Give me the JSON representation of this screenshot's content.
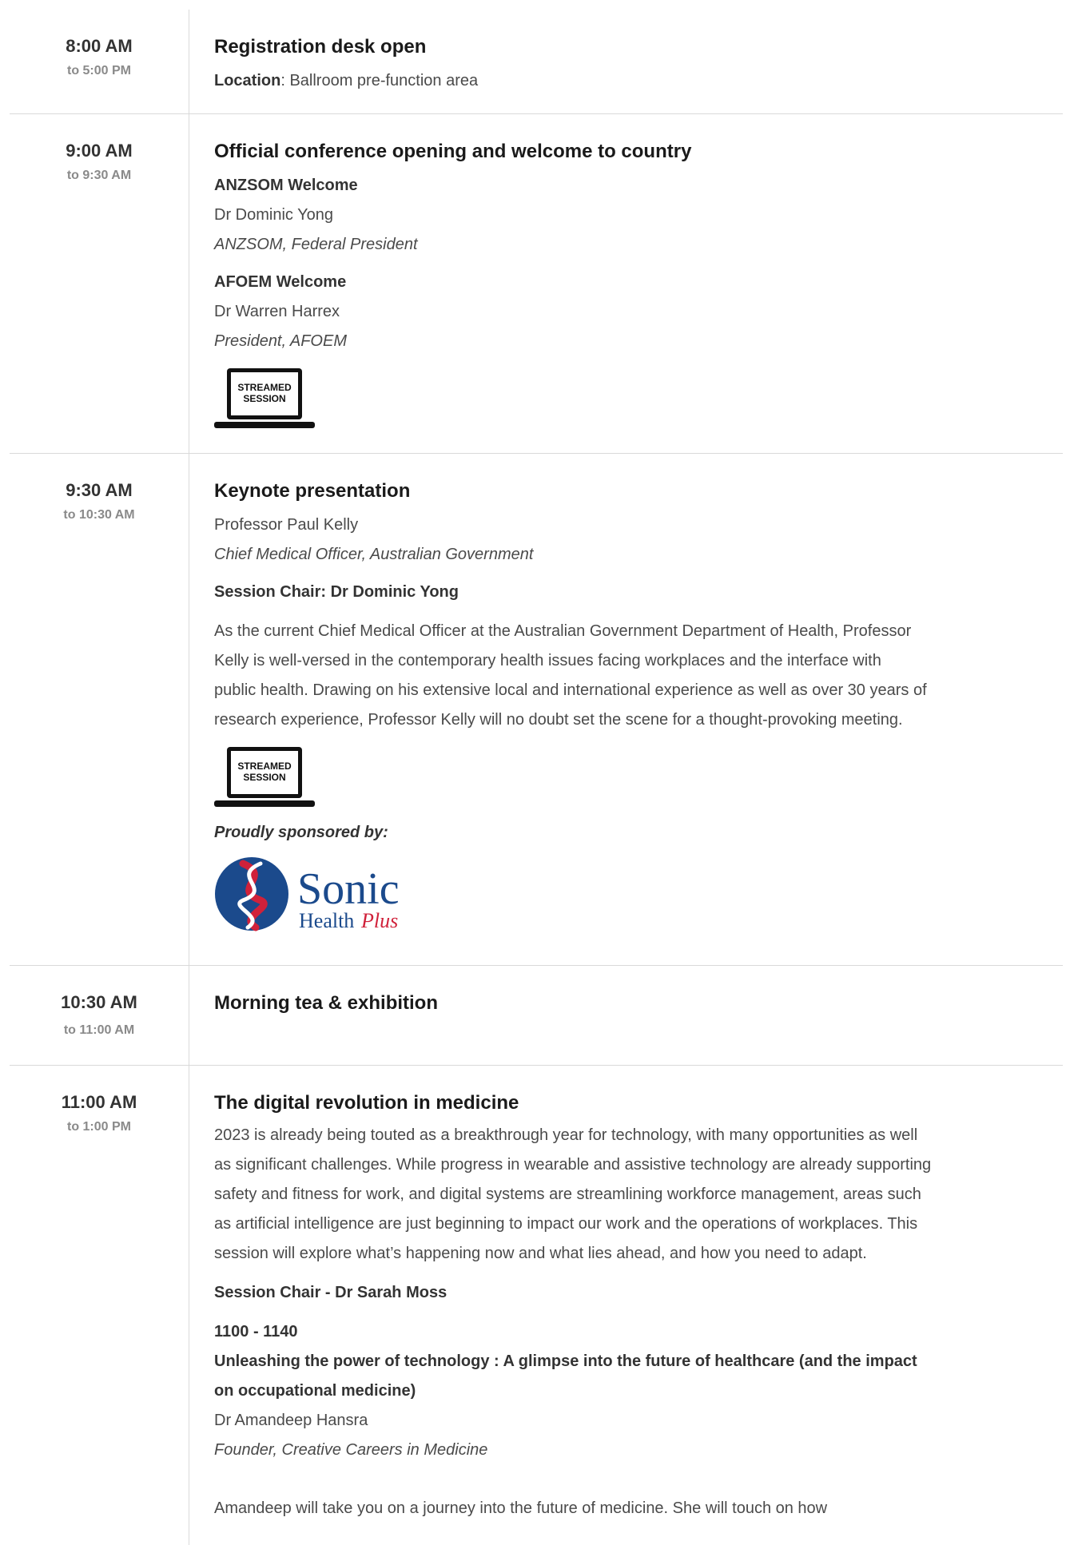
{
  "sessions": [
    {
      "start": "8:00 AM",
      "end": "to 5:00 PM",
      "title": "Registration desk open",
      "location_label": "Location",
      "location_value": ": Ballroom pre-function area"
    },
    {
      "start": "9:00 AM",
      "end": "to 9:30 AM",
      "title": "Official conference opening and welcome to country",
      "groups": [
        {
          "heading": "ANZSOM Welcome",
          "name": "Dr Dominic Yong",
          "role": "ANZSOM, Federal President"
        },
        {
          "heading": "AFOEM Welcome",
          "name": "Dr Warren Harrex",
          "role": "President, AFOEM"
        }
      ],
      "badge": [
        "STREAMED",
        "SESSION"
      ]
    },
    {
      "start": "9:30 AM",
      "end": "to 10:30 AM",
      "title": "Keynote presentation",
      "speaker": "Professor Paul Kelly",
      "role": "Chief Medical Officer, Australian Government",
      "chair": "Session Chair: Dr Dominic Yong",
      "desc_lines": [
        "As the current Chief Medical Officer at the Australian Government Department of Health, Professor",
        "Kelly is well-versed in the contemporary health issues facing workplaces and the interface with",
        "public health. Drawing on his extensive local and international experience as well as over 30 years of",
        "research experience, Professor Kelly will no doubt set the scene for a thought-provoking meeting."
      ],
      "badge": [
        "STREAMED",
        "SESSION"
      ],
      "sponsor_label": "Proudly sponsored by:",
      "sponsor": {
        "word1": "Sonic",
        "word2a": "Health",
        "word2b": "Plus",
        "blue": "#1b4a8c",
        "red": "#d0213a"
      }
    },
    {
      "start": "10:30 AM",
      "end": "to 11:00 AM",
      "title": "Morning tea & exhibition"
    },
    {
      "start": "11:00 AM",
      "end": "to 1:00 PM",
      "title": "The digital revolution in medicine",
      "desc_lines": [
        "2023 is already being touted as a breakthrough year for technology, with many opportunities as well",
        "as significant challenges. While progress in wearable and assistive technology are already supporting",
        "safety and fitness for work, and digital systems are streamlining workforce management, areas such",
        "as artificial intelligence are just beginning to impact our work and the operations of workplaces. This",
        "session will explore what’s happening now and what lies ahead, and how you need to adapt."
      ],
      "chair": "Session Chair - Dr Sarah Moss",
      "talk_time": "1100 - 1140",
      "talk_title_lines": [
        "Unleashing the power of technology : A glimpse into the future of healthcare (and the impact",
        "on occupational medicine)"
      ],
      "talk_speaker": "Dr Amandeep Hansra",
      "talk_role": "Founder, Creative Careers in Medicine",
      "talk_desc": "Amandeep will take you on a journey into the future of medicine. She will touch on how"
    }
  ]
}
